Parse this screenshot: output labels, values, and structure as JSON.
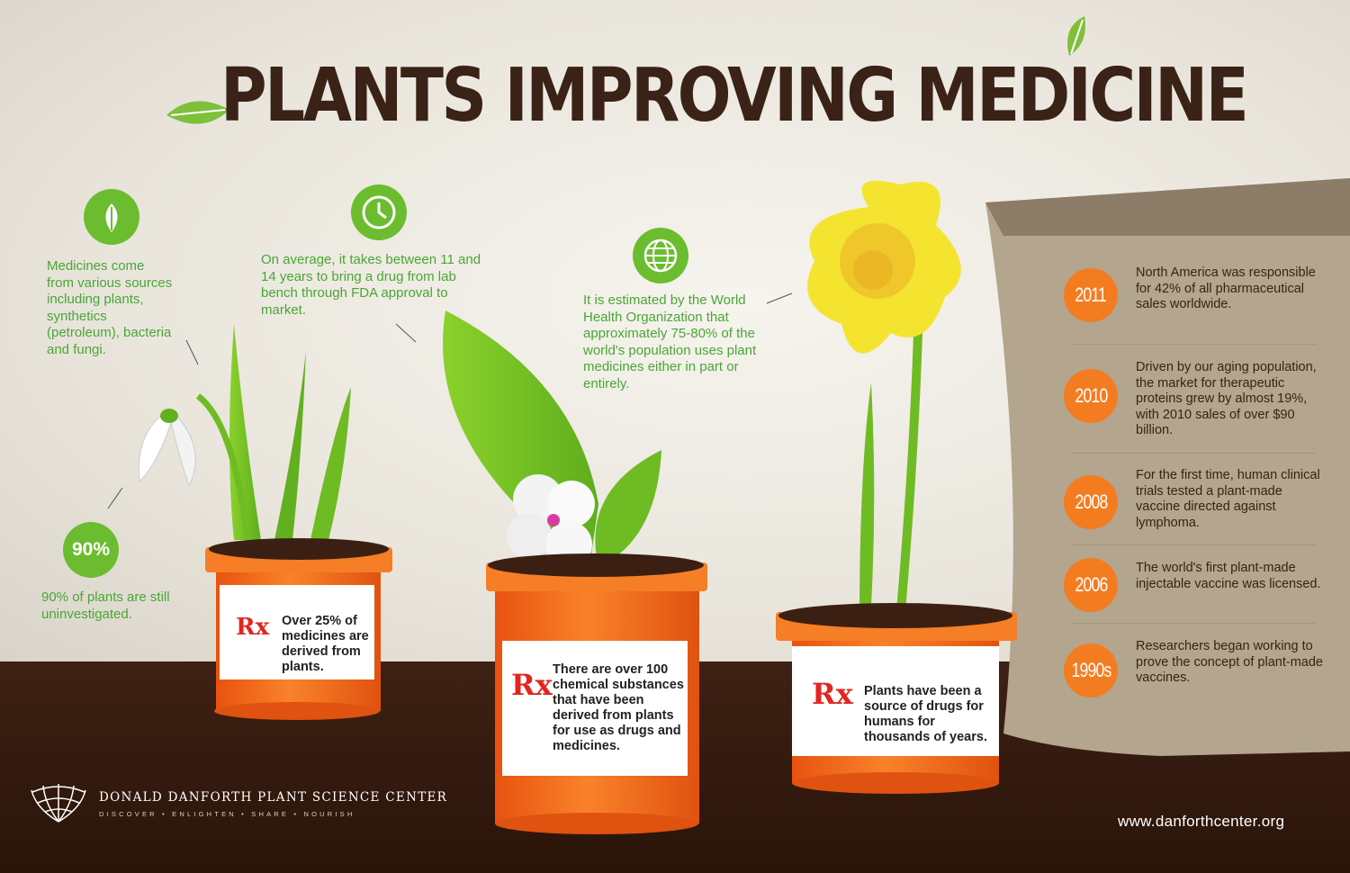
{
  "title": "PLANTS IMPROVING MEDICINE",
  "facts": {
    "sources": "Medicines come from various sources including plants, synthetics (petroleum), bacteria and fungi.",
    "years": "On average, it takes between 11 and 14 years to bring a drug from lab bench through FDA approval to market.",
    "who": "It is estimated by the World Health Organization that approximately 75-80% of the world's population uses plant medicines either in part or entirely.",
    "stat_badge": "90%",
    "stat_text": "90% of plants are still uninvestigated."
  },
  "pots": [
    {
      "rx": "Rx",
      "text": "Over 25% of medicines are derived from plants."
    },
    {
      "rx": "Rx",
      "text": "There are over 100 chemical substances that have been derived from plants for use as drugs and medicines."
    },
    {
      "rx": "Rx",
      "text": "Plants have been a source of drugs for humans for thousands of years."
    }
  ],
  "timeline": [
    {
      "year": "2011",
      "text": "North America was responsible for 42% of all pharmaceutical sales worldwide."
    },
    {
      "year": "2010",
      "text": "Driven by our aging population, the market for therapeutic proteins grew by almost 19%, with 2010 sales of over $90 billion."
    },
    {
      "year": "2008",
      "text": "For the first time, human clinical trials tested a plant-made vaccine directed against lymphoma."
    },
    {
      "year": "2006",
      "text": "The world's first plant-made injectable vaccine was licensed."
    },
    {
      "year": "1990s",
      "text": "Researchers began working to prove the concept of plant-made vaccines."
    }
  ],
  "footer": {
    "org": "DONALD DANFORTH PLANT SCIENCE CENTER",
    "tagline": "DISCOVER • ENLIGHTEN • SHARE • NOURISH",
    "url": "www.danforthcenter.org"
  },
  "icons": [
    "leaf-icon",
    "clock-icon",
    "globe-icon",
    "danforth-logo-icon"
  ],
  "colors": {
    "green": "#6bbd2f",
    "orange": "#f47c20",
    "brown": "#3a2216",
    "red": "#e2261f"
  }
}
